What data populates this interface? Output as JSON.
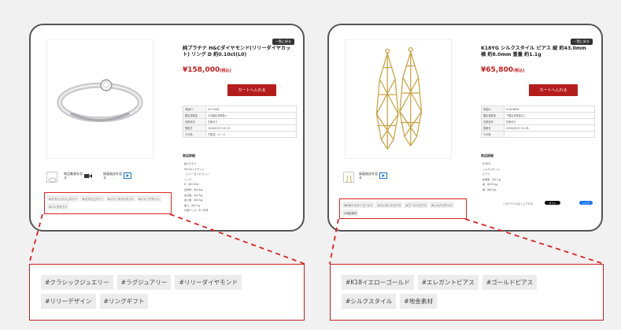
{
  "left": {
    "back_link": "一覧に戻る",
    "title": "純プラチナ H&Cダイヤモンド(リリーダイヤカット) リング D 約0.10ct(L0)",
    "price": "¥158,000",
    "tax": "(税込)",
    "cart_label": "カートへ入れる",
    "specs": [
      {
        "k": "商品ID",
        "v": "00713A6"
      },
      {
        "k": "鑑定書取扱",
        "v": "GIA鑑定書取扱い"
      },
      {
        "k": "在庫状況",
        "v": "在庫あり"
      },
      {
        "k": "登録日",
        "v": "2026/03/27 00:15"
      },
      {
        "k": "その他",
        "v": "付属品：ケース"
      }
    ],
    "section_title": "商品詳細",
    "desc_lines": [
      "純プラチナ",
      "H&Cダイヤモンド",
      "（リリーダイヤカット）",
      "リング",
      "D：約0.10ct",
      "最低厚：約1.4㎜",
      "最大幅：約2.5㎜",
      "最小幅：約2.0㎜",
      "重さ：約3.5ｇ",
      "付属サイズ：8～18号"
    ],
    "video_label": "商品動画を見る",
    "live_label": "録画放送を見る",
    "tags": [
      "#クラシックジュエリー",
      "#ラグジュアリー",
      "#リリーダイヤモンド",
      "#リリーデザイン",
      "#リングギフト"
    ]
  },
  "right": {
    "back_link": "一覧に戻る",
    "title": "K18YG シルクスタイル ピアス 縦 約43.0mm 横 約8.0mm 重量 約1.1g",
    "price": "¥65,800",
    "tax": "(税込)",
    "cart_label": "カートへ入れる",
    "specs": [
      {
        "k": "商品ID",
        "v": "01003856"
      },
      {
        "k": "鑑定書取扱",
        "v": "下鑑定書取扱なし"
      },
      {
        "k": "在庫状況",
        "v": "在庫あり"
      },
      {
        "k": "登録日",
        "v": "2026/03/27 01:38"
      },
      {
        "k": "その他",
        "v": ""
      }
    ],
    "section_title": "商品詳細",
    "desc_lines": [
      "K18YG",
      "シルクスタイル",
      "ピアス",
      "総重量：約1.1ｇ",
      "縦：約43.0㎜",
      "横：約8.0㎜"
    ],
    "live_label": "録画放送を見る",
    "share_text": "このアイテムをシェアする",
    "share_x": "ポスト",
    "share_fb": "シェア",
    "tags": [
      "#K18イエローゴールド",
      "#エレガントピアス",
      "#ゴールドピアス",
      "#シルクスタイル",
      "#地金素材"
    ]
  },
  "zoom_left_tags": [
    "#クラシックジュエリー",
    "#ラグジュアリー",
    "#リリーダイヤモンド",
    "#リリーデザイン",
    "#リングギフト"
  ],
  "zoom_right_tags": [
    "#K18イエローゴールド",
    "#エレガントピアス",
    "#ゴールドピアス",
    "#シルクスタイル",
    "#地金素材"
  ],
  "colors": {
    "accent": "#c41e1e",
    "cart": "#b51d1d",
    "frame": "#555555"
  }
}
